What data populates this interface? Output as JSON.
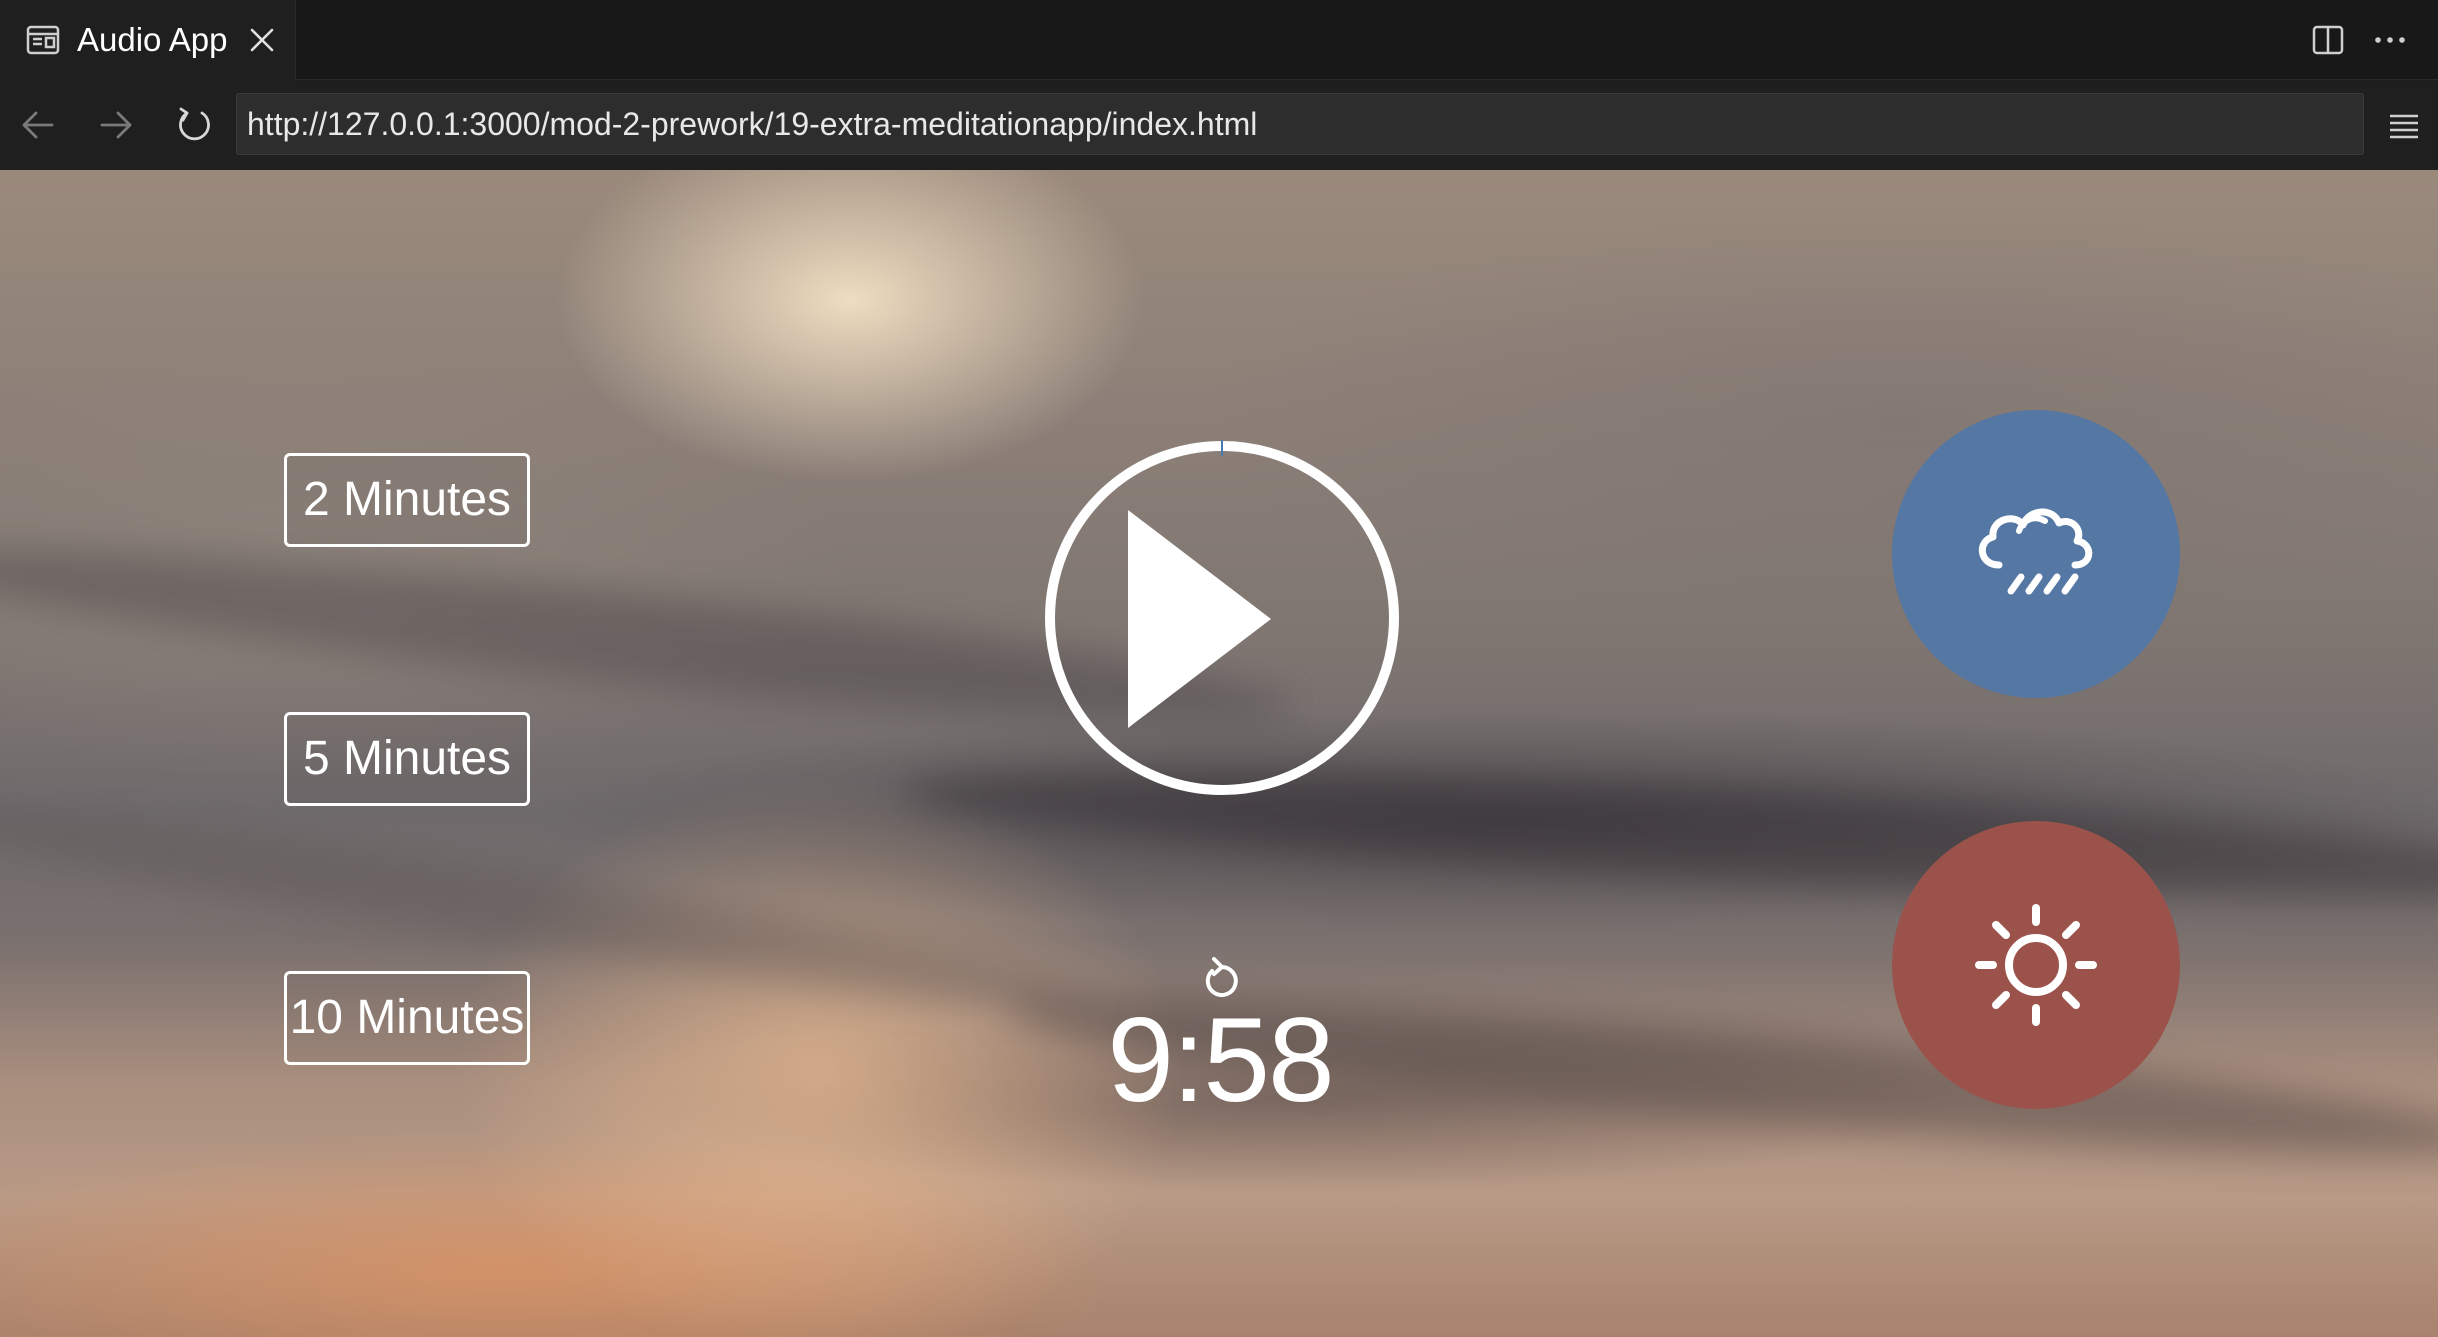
{
  "browser": {
    "tab": {
      "title": "Audio App",
      "icon": "page-icon",
      "close_icon": "close-icon"
    },
    "toolbar_icons": [
      "split-editor-icon",
      "more-actions-icon"
    ],
    "nav": {
      "back_icon": "arrow-left-icon",
      "forward_icon": "arrow-right-icon",
      "reload_icon": "reload-icon",
      "url": "http://127.0.0.1:3000/mod-2-prework/19-extra-meditationapp/index.html",
      "menu_icon": "menu-icon"
    }
  },
  "app": {
    "time_select": [
      {
        "label": "2 Minutes"
      },
      {
        "label": "5 Minutes"
      },
      {
        "label": "10 Minutes"
      }
    ],
    "player": {
      "icon": "play-icon",
      "progress": 0.0
    },
    "replay_icon": "replay-icon",
    "time_display": "9:58",
    "sound_picker": [
      {
        "name": "rain",
        "icon": "cloud-rain-icon",
        "color": "#5477a4"
      },
      {
        "name": "beach",
        "icon": "sun-icon",
        "color": "#9b524b"
      }
    ]
  }
}
